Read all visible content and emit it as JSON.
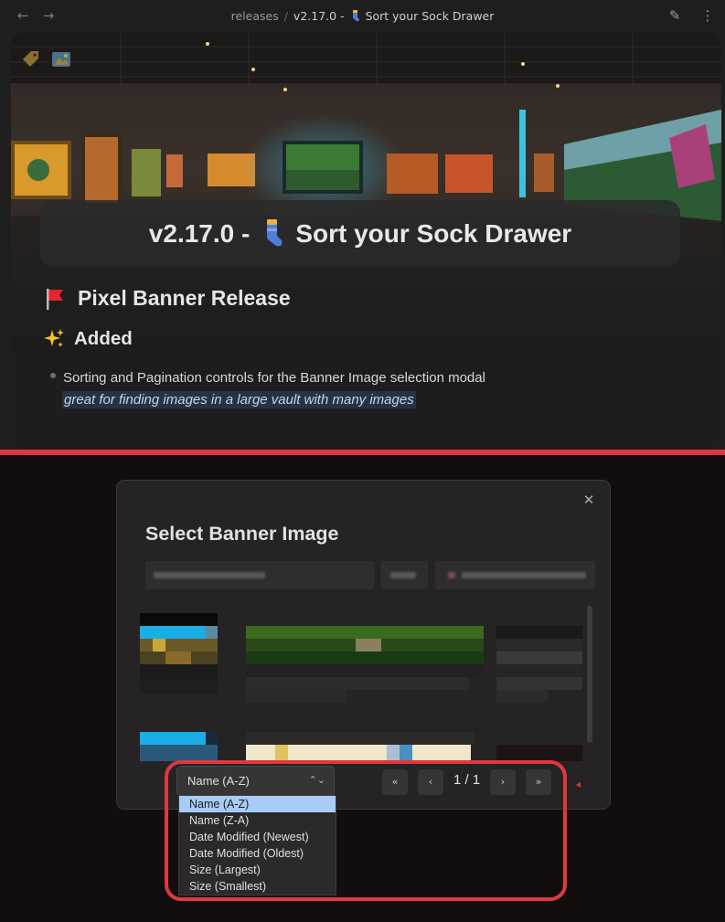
{
  "topbar": {
    "breadcrumb_folder": "releases",
    "breadcrumb_sep": "/",
    "breadcrumb_version": "v2.17.0 -",
    "breadcrumb_title": "Sort your Sock Drawer",
    "icons": [
      "arrow-left-icon",
      "arrow-right-icon",
      "pencil-icon",
      "more-vertical-icon"
    ]
  },
  "banner": {
    "title_version": "v2.17.0 -",
    "title_name": "Sort your Sock Drawer",
    "icons": [
      "tag-icon",
      "image-icon",
      "sock-icon"
    ]
  },
  "note": {
    "h2_text": "Pixel Banner Release",
    "h2_emoji": "red-flag",
    "h3_text": "Added",
    "h3_emoji": "sparkles",
    "bullet_line1": "Sorting and Pagination controls for the Banner Image selection modal",
    "bullet_line2": "great for finding images in a large vault with many images"
  },
  "modal": {
    "title": "Select Banner Image",
    "close_glyph": "✕",
    "sort_selected": "Name (A-Z)",
    "page_indicator": "1 / 1",
    "pagination": {
      "first": "«",
      "prev": "‹",
      "next": "›",
      "last": "»"
    },
    "sort_options": [
      "Name (A-Z)",
      "Name (Z-A)",
      "Date Modified (Newest)",
      "Date Modified (Oldest)",
      "Size (Largest)",
      "Size (Smallest)"
    ]
  },
  "colors": {
    "accent_red": "#e0383e",
    "selected_option": "#a8ccf5",
    "modal_bg": "#252324",
    "page_bg": "#1e1e1e"
  }
}
